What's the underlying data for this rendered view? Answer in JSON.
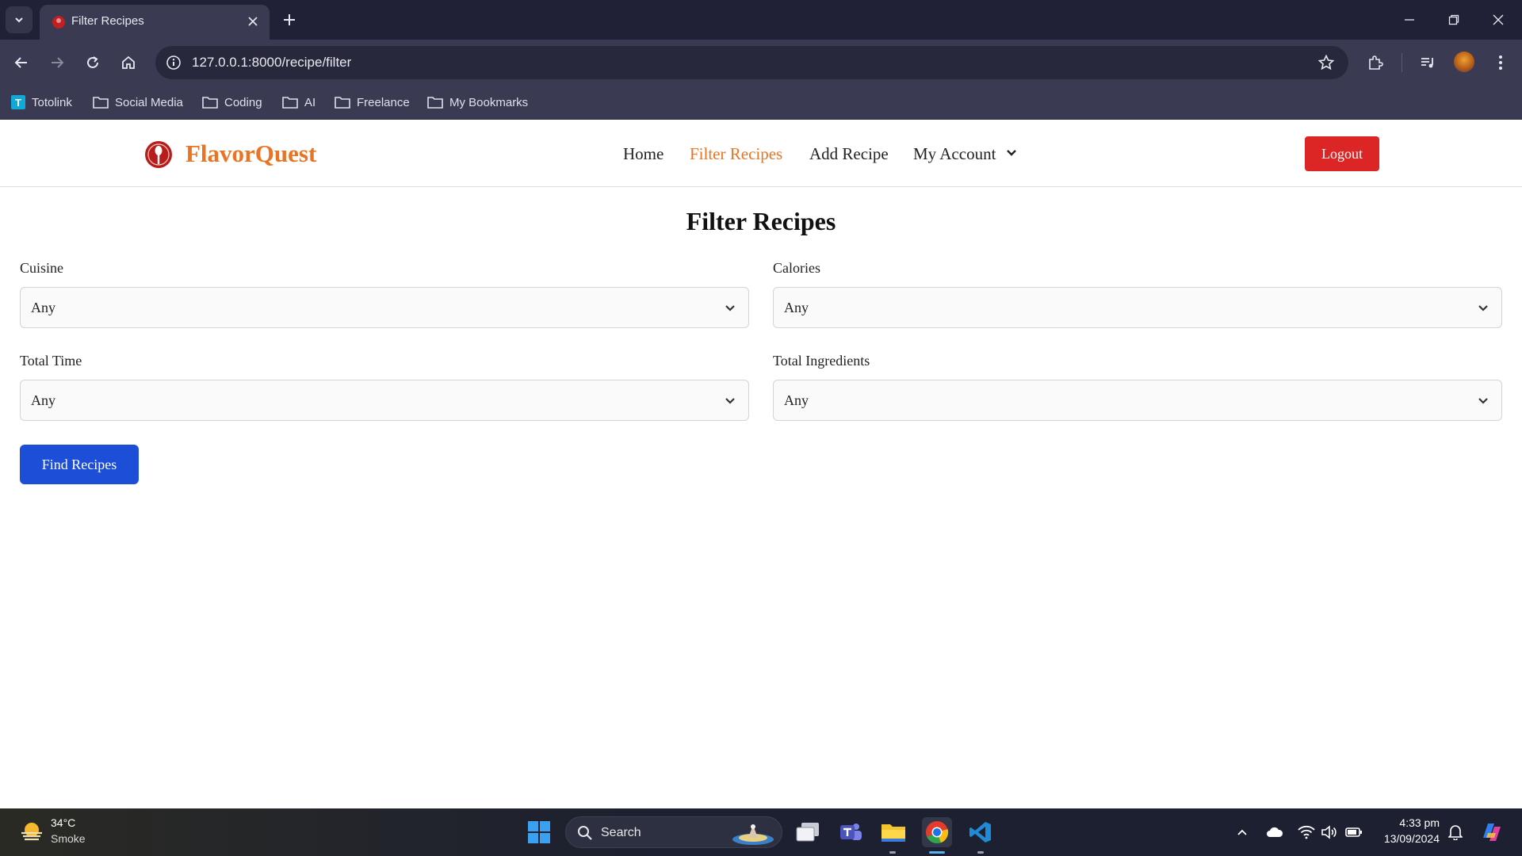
{
  "browser": {
    "tab_title": "Filter Recipes",
    "url": "127.0.0.1:8000/recipe/filter",
    "bookmarks": [
      {
        "label": "Totolink",
        "icon": "totolink-logo"
      },
      {
        "label": "Social Media",
        "icon": "folder-icon"
      },
      {
        "label": "Coding",
        "icon": "folder-icon"
      },
      {
        "label": "AI",
        "icon": "folder-icon"
      },
      {
        "label": "Freelance",
        "icon": "folder-icon"
      },
      {
        "label": "My Bookmarks",
        "icon": "folder-icon"
      }
    ],
    "totolink_letter": "T"
  },
  "site": {
    "brand": "FlavorQuest",
    "nav": {
      "home": "Home",
      "filter": "Filter Recipes",
      "add": "Add Recipe",
      "account": "My Account"
    },
    "logout": "Logout",
    "accent_color": "#ea7424",
    "logout_color": "#dc2626"
  },
  "filter": {
    "title": "Filter Recipes",
    "fields": {
      "cuisine": {
        "label": "Cuisine",
        "value": "Any"
      },
      "calories": {
        "label": "Calories",
        "value": "Any"
      },
      "total_time": {
        "label": "Total Time",
        "value": "Any"
      },
      "total_ingredients": {
        "label": "Total Ingredients",
        "value": "Any"
      }
    },
    "submit": "Find Recipes",
    "submit_color": "#1d4ed8"
  },
  "taskbar": {
    "weather_temp": "34°C",
    "weather_cond": "Smoke",
    "search": "Search",
    "time": "4:33 pm",
    "date": "13/09/2024"
  }
}
